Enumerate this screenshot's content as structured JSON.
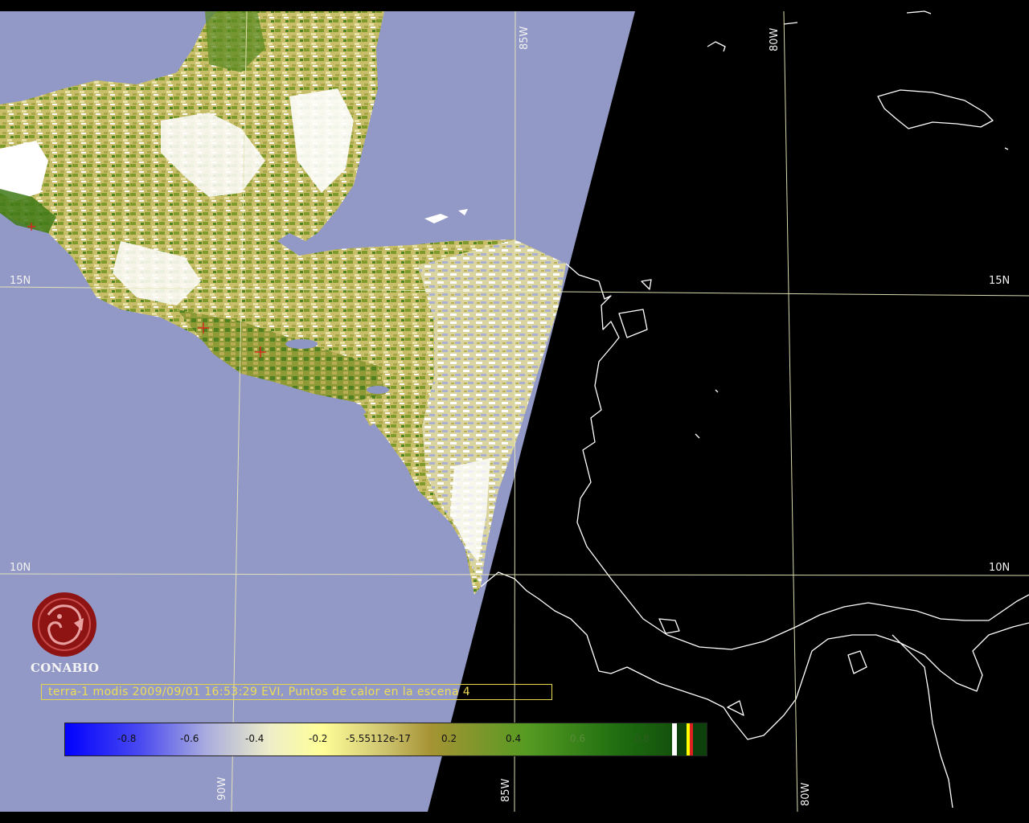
{
  "caption": "terra-1 modis 2009/09/01 16:53:29 EVI, Puntos de calor en la escena 4",
  "logo": {
    "text": "CONABIO",
    "icon": "conabio-logo"
  },
  "graticule": {
    "lat_labels": [
      "15N",
      "15N",
      "10N",
      "10N"
    ],
    "lon_labels": [
      "85W",
      "80W",
      "90W",
      "85W",
      "80W"
    ]
  },
  "colorbar": {
    "ticks": [
      "-0.8",
      "-0.6",
      "-0.4",
      "-0.2",
      "-5.55112e-17",
      "0.2",
      "0.4",
      "0.6",
      "0.8"
    ]
  },
  "colors": {
    "ocean": "#9399c6",
    "night": "#000000",
    "caption": "#eede55",
    "hotspot": "#e02020",
    "logo": "#8e1414"
  }
}
